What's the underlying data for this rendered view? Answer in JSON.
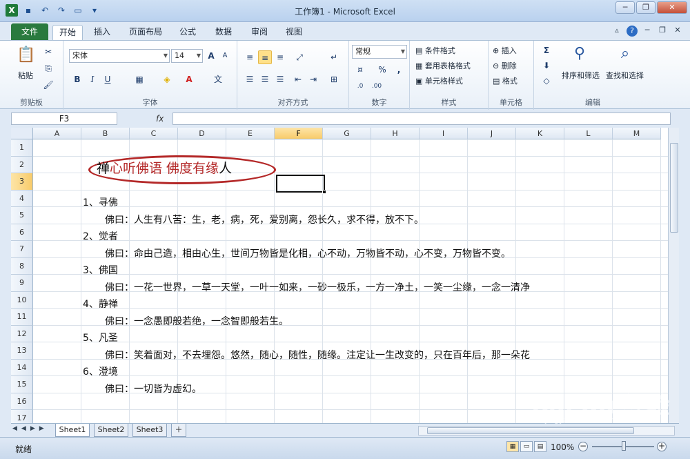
{
  "window": {
    "title": "工作簿1 - Microsoft Excel"
  },
  "ribbon_tabs": [
    "文件",
    "开始",
    "插入",
    "页面布局",
    "公式",
    "数据",
    "审阅",
    "视图"
  ],
  "ribbon": {
    "clipboard": {
      "paste": "粘贴",
      "label": "剪贴板"
    },
    "font": {
      "name": "宋体",
      "size": "14",
      "bold": "B",
      "italic": "I",
      "underline": "U",
      "grow": "A",
      "shrink": "A",
      "label": "字体"
    },
    "alignment": {
      "label": "对齐方式"
    },
    "number": {
      "format": "常规",
      "percent": "%",
      "comma": ",",
      "label": "数字"
    },
    "styles": {
      "conditional": "条件格式",
      "table": "套用表格格式",
      "cell": "单元格样式",
      "label": "样式"
    },
    "cells": {
      "insert": "插入",
      "delete": "删除",
      "format": "格式",
      "label": "单元格"
    },
    "editing": {
      "sort": "排序和筛选",
      "find": "查找和选择",
      "sigma": "Σ",
      "label": "编辑"
    }
  },
  "formula_bar": {
    "name_box": "F3",
    "fx": "fx",
    "value": ""
  },
  "columns": [
    "A",
    "B",
    "C",
    "D",
    "E",
    "F",
    "G",
    "H",
    "I",
    "J",
    "K",
    "L",
    "M"
  ],
  "active_column": "F",
  "rows": [
    "1",
    "2",
    "3",
    "4",
    "5",
    "6",
    "7",
    "8",
    "9",
    "10",
    "11",
    "12",
    "13",
    "14",
    "15",
    "16",
    "17"
  ],
  "active_row": "3",
  "title": {
    "part1": "禅",
    "part2": "心听佛语  佛度有缘",
    "part3": "人"
  },
  "cells": {
    "r4": "1、寻佛",
    "r5": "佛曰：人生有八苦：生，老，病，死，爱别离，怨长久，求不得，放不下。",
    "r6": "2、觉者",
    "r7": "佛曰：命由己造，相由心生，世间万物皆是化相，心不动，万物皆不动，心不变，万物皆不变。",
    "r8": "3、佛国",
    "r9": "佛曰：一花一世界，一草一天堂，一叶一如来，一砂一极乐，一方一净土，一笑一尘缘，一念一清净",
    "r10": "4、静禅",
    "r11": "佛曰：一念愚即般若绝，一念智即般若生。",
    "r12": "5、凡圣",
    "r13": "佛曰：笑着面对，不去埋怨。悠然，随心，随性，随缘。注定让一生改变的，只在百年后，那一朵花",
    "r14": "6、澄境",
    "r15": "佛曰：一切皆为虚幻。"
  },
  "sheets": [
    "Sheet1",
    "Sheet2",
    "Sheet3"
  ],
  "status": {
    "ready": "就绪",
    "zoom": "100%"
  },
  "watermark": {
    "brand": "Bai du 经验",
    "url": "jingyan.baidu.com"
  },
  "colors": {
    "title_red": "#b42828",
    "file_tab": "#2a7a3f"
  }
}
